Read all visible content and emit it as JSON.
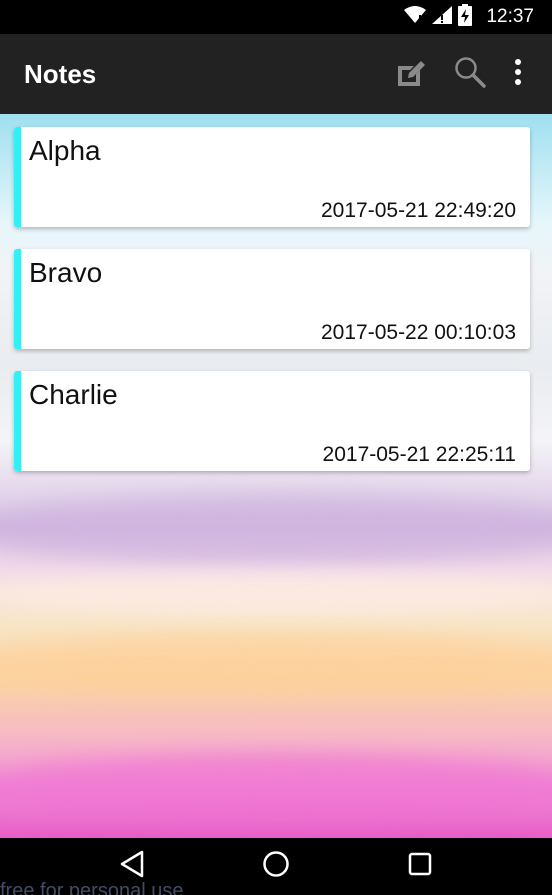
{
  "status_bar": {
    "time": "12:37",
    "icons": [
      "wifi-icon",
      "signal-icon",
      "battery-charging-icon"
    ]
  },
  "app_bar": {
    "title": "Notes",
    "actions": [
      "edit-note-icon",
      "search-icon",
      "overflow-menu-icon"
    ]
  },
  "colors": {
    "app_bar": "#222222",
    "accent": "#33f0f5",
    "card": "#ffffff"
  },
  "notes": [
    {
      "title": "Alpha",
      "date": "2017-05-21 22:49:20"
    },
    {
      "title": "Bravo",
      "date": "2017-05-22 00:10:03"
    },
    {
      "title": "Charlie",
      "date": "2017-05-21 22:25:11"
    }
  ],
  "nav_bar": {
    "buttons": [
      "back-icon",
      "home-icon",
      "recents-icon"
    ]
  },
  "watermark": "free for personal use"
}
